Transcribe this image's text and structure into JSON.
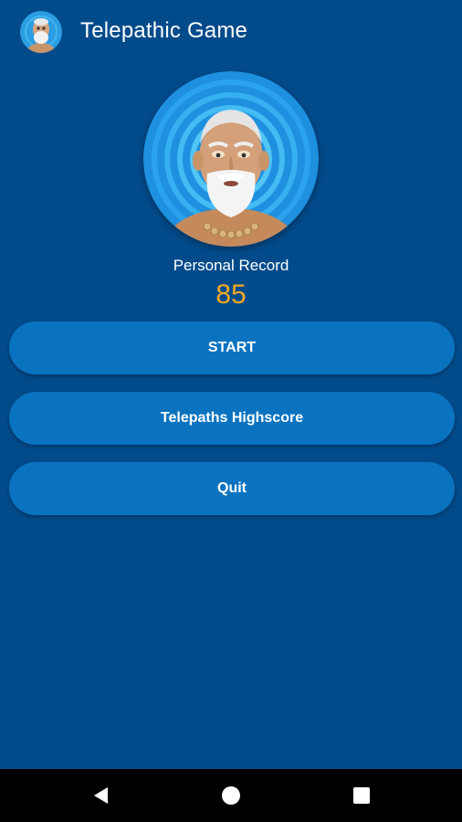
{
  "app": {
    "title": "Telepathic Game",
    "icon": "old-man-avatar-icon"
  },
  "hero": {
    "image": "telepath-old-man-portrait"
  },
  "record": {
    "label": "Personal Record",
    "value": "85"
  },
  "buttons": {
    "start": "START",
    "highscore": "Telepaths Highscore",
    "quit": "Quit"
  },
  "nav": {
    "back_icon": "back-triangle-icon",
    "home_icon": "home-circle-icon",
    "recents_icon": "recents-square-icon"
  },
  "colors": {
    "background": "#024b8b",
    "button": "#0a73c0",
    "record_value": "#f6a823",
    "nav_bar": "#000000"
  }
}
